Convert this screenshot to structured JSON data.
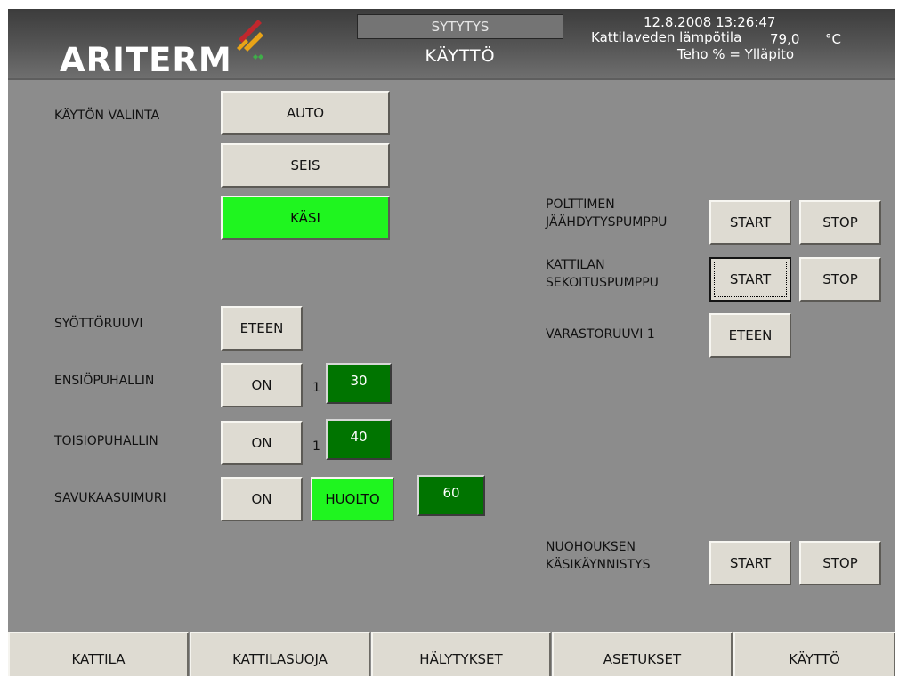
{
  "header": {
    "logo": "ARITERM",
    "status": "SYTYTYS",
    "mode": "KÄYTTÖ",
    "datetime": "12.8.2008 13:26:47",
    "water_temp_label": "Kattilaveden lämpötila",
    "water_temp_value": "79,0",
    "water_temp_unit": "°C",
    "power": "Teho % = Ylläpito"
  },
  "mode_select": {
    "label": "KÄYTÖN VALINTA",
    "auto": "AUTO",
    "stop": "SEIS",
    "manual": "KÄSI",
    "active": "KÄSI"
  },
  "feed_screw": {
    "label": "SYÖTTÖRUUVI",
    "button": "ETEEN"
  },
  "primary_fan": {
    "label": "ENSIÖPUHALLIN",
    "button": "ON",
    "index": "1",
    "value": "30"
  },
  "secondary_fan": {
    "label": "TOISIOPUHALLIN",
    "button": "ON",
    "index": "1",
    "value": "40"
  },
  "flue_fan": {
    "label": "SAVUKAASUIMURI",
    "button": "ON",
    "service": "HUOLTO",
    "value": "60"
  },
  "burner_pump": {
    "label_line1": "POLTTIMEN",
    "label_line2": "JÄÄHDYTYSPUMPPU",
    "start": "START",
    "stop": "STOP"
  },
  "boiler_pump": {
    "label_line1": "KATTILAN",
    "label_line2": "SEKOITUSPUMPPU",
    "start": "START",
    "stop": "STOP"
  },
  "storage_screw": {
    "label": "VARASTORUUVI 1",
    "button": "ETEEN"
  },
  "sooting": {
    "label_line1": "NUOHOUKSEN",
    "label_line2": "KÄSIKÄYNNISTYS",
    "start": "START",
    "stop": "STOP"
  },
  "tabs": [
    "KATTILA",
    "KATTILASUOJA",
    "HÄLYTYKSET",
    "ASETUKSET",
    "KÄYTTÖ"
  ],
  "colors": {
    "active_green": "#1ff51f",
    "value_green": "#007400",
    "panel_gray": "#8c8c8c",
    "button_face": "#dedbd2"
  }
}
